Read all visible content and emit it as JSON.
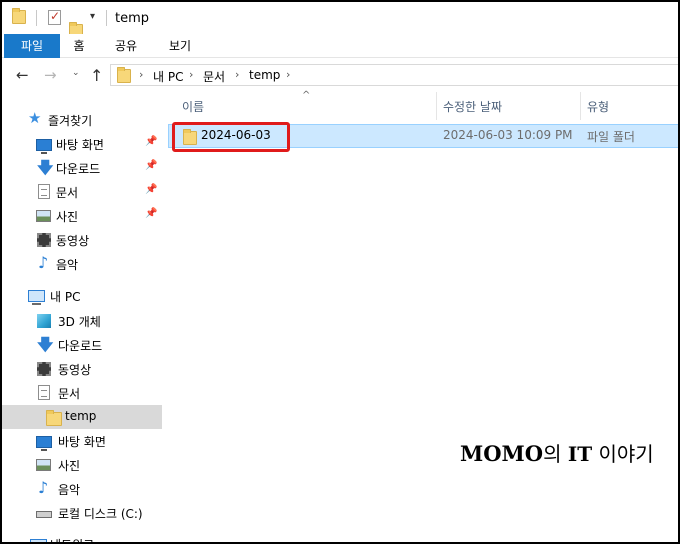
{
  "window": {
    "title": "temp"
  },
  "ribbon": {
    "tabs": [
      "파일",
      "홈",
      "공유",
      "보기"
    ],
    "active_color": "#1979ca"
  },
  "address": {
    "crumbs": [
      "내 PC",
      "문서",
      "temp"
    ]
  },
  "nav_pane": {
    "quick_access": {
      "label": "즐겨찾기",
      "icon": "star-icon"
    },
    "quick_items": [
      {
        "label": "바탕 화면",
        "icon": "desktop-icon",
        "pinned": true
      },
      {
        "label": "다운로드",
        "icon": "download-icon",
        "pinned": true
      },
      {
        "label": "문서",
        "icon": "document-icon",
        "pinned": true
      },
      {
        "label": "사진",
        "icon": "pictures-icon",
        "pinned": true
      },
      {
        "label": "동영상",
        "icon": "video-icon",
        "pinned": false
      },
      {
        "label": "음악",
        "icon": "music-icon",
        "pinned": false
      }
    ],
    "this_pc": {
      "label": "내 PC",
      "icon": "pc-icon"
    },
    "pc_items": [
      {
        "label": "3D 개체",
        "icon": "3d-objects-icon"
      },
      {
        "label": "다운로드",
        "icon": "download-icon"
      },
      {
        "label": "동영상",
        "icon": "video-icon"
      },
      {
        "label": "문서",
        "icon": "document-icon"
      },
      {
        "label": "temp",
        "icon": "folder-icon",
        "selected": true
      },
      {
        "label": "바탕 화면",
        "icon": "desktop-icon"
      },
      {
        "label": "사진",
        "icon": "pictures-icon"
      },
      {
        "label": "음악",
        "icon": "music-icon"
      },
      {
        "label": "로컬 디스크 (C:)",
        "icon": "drive-icon"
      }
    ],
    "network": {
      "label": "네트워크"
    }
  },
  "columns": {
    "name": "이름",
    "date": "수정한 날짜",
    "type": "유형"
  },
  "files": [
    {
      "name": "2024-06-03",
      "modified": "2024-06-03 10:09 PM",
      "type": "파일 폴더",
      "selected": true
    }
  ],
  "highlight_color": "#e01b1b",
  "watermark": {
    "brand": "MOMO",
    "text1": "의 ",
    "brand2": "IT",
    "text2": " 이야기"
  }
}
